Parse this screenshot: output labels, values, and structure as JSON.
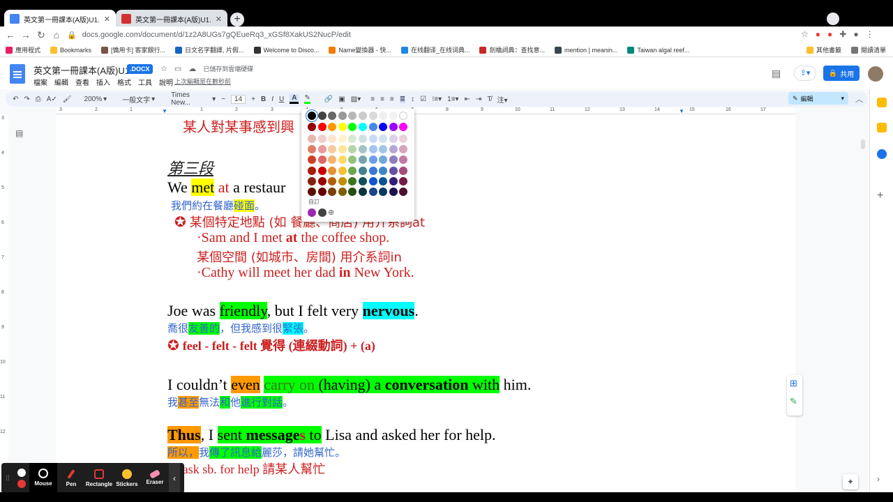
{
  "browser": {
    "tabs": [
      {
        "title": "英文第一冊課本(A版)U1.docx - G",
        "active": true
      },
      {
        "title": "英文第一冊課本(A版)U1.pdf - Li",
        "active": false
      }
    ],
    "url": "docs.google.com/document/d/1z2A8UGs7gQEueRq3_xGSf8XakUS2NucP/edit",
    "bookmarks": [
      "應用程式",
      "Bookmarks",
      "[僑用卡] 客家銀行...",
      "日文名字翻譯, 片假...",
      "Welcome to Disco...",
      "Name變換器 - 快...",
      "在线翻译_在线词典...",
      "劍橋詞典：查找意...",
      "mention | meanin...",
      "Taiwan algal reef..."
    ],
    "bookmarks_right": [
      "其他書籤",
      "閱讀清單"
    ]
  },
  "docs": {
    "title": "英文第一冊課本(A版)U1",
    "badge": ".DOCX",
    "saved": "已儲存到雲端硬碟",
    "menus": [
      "檔案",
      "編輯",
      "查看",
      "插入",
      "格式",
      "工具",
      "說明"
    ],
    "last_edit": "上次編輯是在數秒前",
    "share": "共用",
    "edit_mode": "編輯"
  },
  "toolbar": {
    "zoom": "200%",
    "style": "一般文字",
    "font": "Times New...",
    "size": "14",
    "bold": "B",
    "italic": "I",
    "underline": "U",
    "text_color": "A"
  },
  "ruler": [
    "3",
    "2",
    "1",
    "1",
    "2",
    "3",
    "4",
    "5",
    "6",
    "7",
    "8",
    "9",
    "10",
    "11",
    "12",
    "13",
    "14",
    "15",
    "16",
    "17"
  ],
  "vruler": [
    "3",
    "4",
    "5",
    "6",
    "7",
    "8",
    "9",
    "10",
    "11",
    "12"
  ],
  "content": {
    "l0": "某人對某事感到興",
    "heading": "第三段",
    "s1": {
      "a": "We ",
      "b": "met",
      "c": " ",
      "d": "at",
      "e": " a restaur"
    },
    "s1cn": {
      "a": "我們約在餐廳",
      "b": "碰面",
      "c": "。"
    },
    "n1": {
      "star": "✪",
      "text": "某個特定地點 (如 餐廳、商店) 用介系詞at"
    },
    "n1a": {
      "a": "·Sam and I met ",
      "b": "at",
      "c": " the coffee shop."
    },
    "n1b": "某個空間 (如城市、房間) 用介系詞in",
    "n1c": {
      "a": "·Cathy will meet her dad ",
      "b": "in",
      "c": " New York."
    },
    "s2": {
      "a": "Joe was ",
      "b": "friendly",
      "c": ", but I felt very ",
      "d": "nervous",
      "e": "."
    },
    "s2cn": {
      "a": "喬很",
      "b": "友善的",
      "c": "，但我感到很",
      "d": "緊張",
      "e": "。"
    },
    "n2": {
      "star": "✪",
      "text": "feel - felt - felt 覺得 (連綴動詞) + (a)"
    },
    "s3": {
      "a": "I couldn’t ",
      "b": "even",
      "c": " ",
      "d": "carry on",
      "e": " (having) a ",
      "f": "conversation",
      "g": " with",
      "h": " him."
    },
    "s3cn": {
      "a": "我",
      "b": "甚至",
      "c": "無法",
      "d": "和",
      "e": "他",
      "f": "進行對話",
      "g": "。"
    },
    "s4": {
      "a": "Thus",
      "b": ", I ",
      "c": "sent ",
      "d": "message",
      "e": "s",
      "f": " to",
      "g": " Lisa and asked her for help."
    },
    "s4cn": {
      "a": "所以，",
      "b": "我",
      "c": "傳了訊息給",
      "d": "麗莎，請她幫忙",
      "e": "。"
    },
    "n4": {
      "star": "✪",
      "text": "ask sb. for help 請某人幫忙"
    }
  },
  "palette": {
    "custom_label": "自訂",
    "add": "⊕",
    "grays": [
      "#000000",
      "#434343",
      "#666666",
      "#999999",
      "#b7b7b7",
      "#cccccc",
      "#d9d9d9",
      "#efefef",
      "#f3f3f3",
      "#ffffff"
    ],
    "brights": [
      "#980000",
      "#ff0000",
      "#ff9900",
      "#ffff00",
      "#00ff00",
      "#00ffff",
      "#4a86e8",
      "#0000ff",
      "#9900ff",
      "#ff00ff"
    ],
    "shades": [
      [
        "#e6b8af",
        "#f4cccc",
        "#fce5cd",
        "#fff2cc",
        "#d9ead3",
        "#d0e0e3",
        "#c9daf8",
        "#cfe2f3",
        "#d9d2e9",
        "#ead1dc"
      ],
      [
        "#dd7e6b",
        "#ea9999",
        "#f9cb9c",
        "#ffe599",
        "#b6d7a8",
        "#a2c4c9",
        "#a4c2f4",
        "#9fc5e8",
        "#b4a7d6",
        "#d5a6bd"
      ],
      [
        "#cc4125",
        "#e06666",
        "#f6b26b",
        "#ffd966",
        "#93c47d",
        "#76a5af",
        "#6d9eeb",
        "#6fa8dc",
        "#8e7cc3",
        "#c27ba0"
      ],
      [
        "#a61c00",
        "#cc0000",
        "#e69138",
        "#f1c232",
        "#6aa84f",
        "#45818e",
        "#3c78d8",
        "#3d85c6",
        "#674ea7",
        "#a64d79"
      ],
      [
        "#85200c",
        "#990000",
        "#b45f06",
        "#bf9000",
        "#38761d",
        "#134f5c",
        "#1155cc",
        "#0b5394",
        "#351c75",
        "#741b47"
      ],
      [
        "#5b0f00",
        "#660000",
        "#783f04",
        "#7f6000",
        "#274e13",
        "#0c343d",
        "#1c4587",
        "#073763",
        "#20124d",
        "#4c1130"
      ]
    ],
    "custom": [
      "#9c27b0",
      "#424242"
    ]
  },
  "annotation_bar": {
    "tools": [
      "Mouse",
      "Pen",
      "Rectangle",
      "Stickers",
      "Eraser"
    ],
    "selected": "Mouse"
  }
}
